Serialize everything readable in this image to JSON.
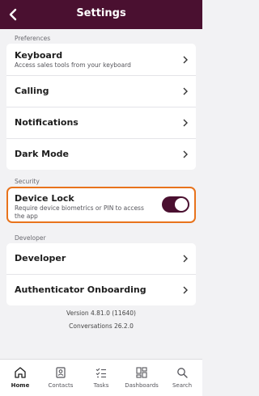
{
  "header": {
    "title": "Settings",
    "back_icon": "chevron-left-icon"
  },
  "sections": {
    "preferences": "Preferences",
    "security": "Security",
    "developer": "Developer"
  },
  "preferences": {
    "keyboard": {
      "label": "Keyboard",
      "sub": "Access sales tools from your keyboard"
    },
    "calling": "Calling",
    "notifications": "Notifications",
    "dark_mode": "Dark Mode"
  },
  "security": {
    "device_lock": {
      "label": "Device Lock",
      "sub": "Require device biometrics or PIN to access the app",
      "enabled": true
    }
  },
  "developer": {
    "developer": "Developer",
    "authenticator": "Authenticator Onboarding"
  },
  "version": {
    "app": "Version 4.81.0 (11640)",
    "conversations": "Conversations 26.2.0"
  },
  "tabs": {
    "home": "Home",
    "contacts": "Contacts",
    "tasks": "Tasks",
    "dashboards": "Dashboards",
    "search": "Search"
  },
  "colors": {
    "brand": "#4a1030",
    "highlight": "#e8731c"
  }
}
